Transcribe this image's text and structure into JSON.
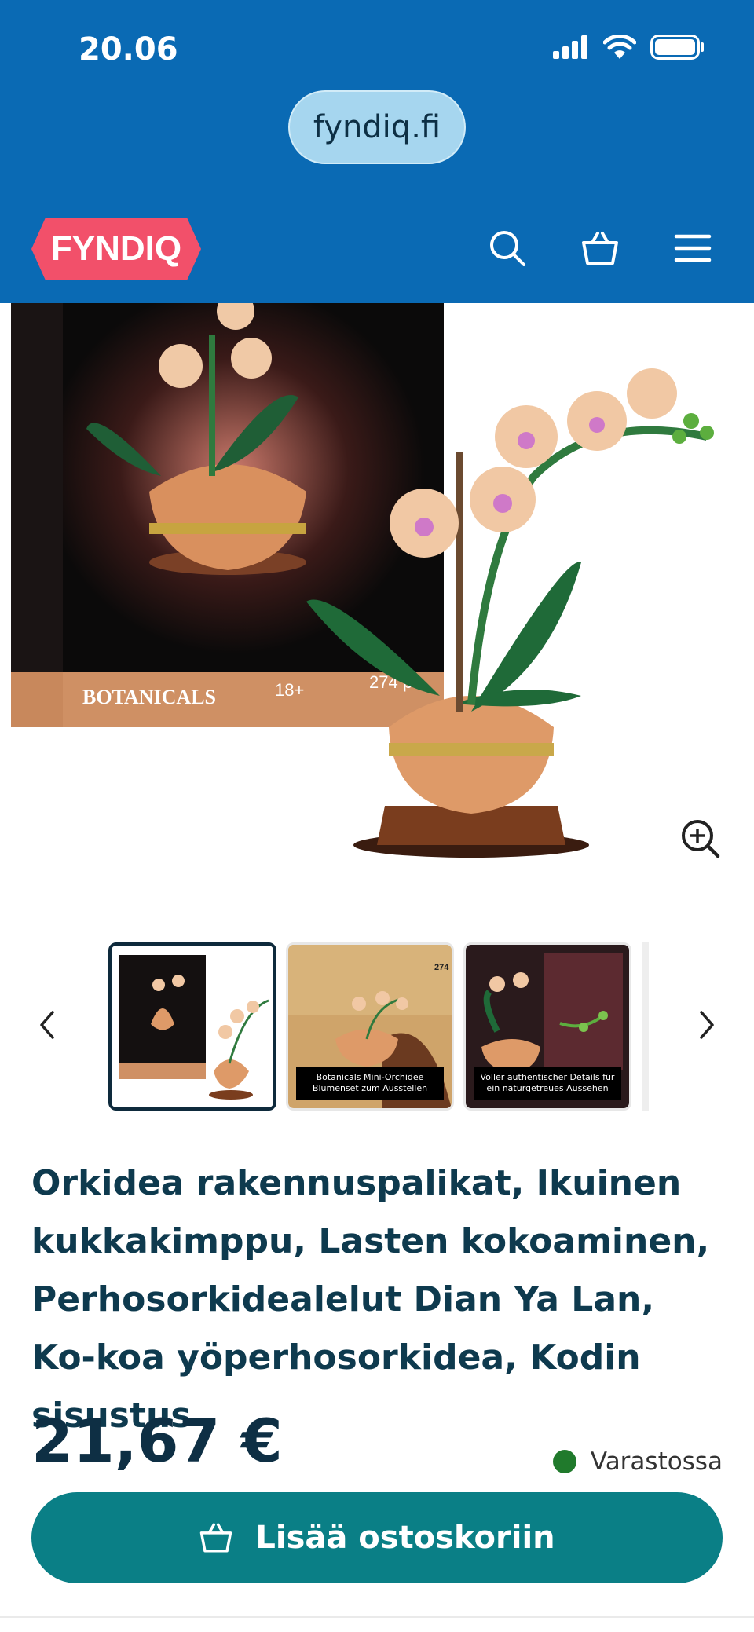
{
  "status_bar": {
    "time": "20.06"
  },
  "browser": {
    "url": "fyndiq.fi"
  },
  "header": {
    "logo_text": "FYNDIQ",
    "brand_color": "#f2506a",
    "icons": [
      "search-icon",
      "cart-icon",
      "menu-icon"
    ]
  },
  "product_image": {
    "box_brand": "BOTANICALS",
    "box_age": "18+",
    "box_pieces": "274 pc"
  },
  "thumbnails": [
    {
      "caption": ""
    },
    {
      "caption": "Botanicals Mini-Orchidee Blumenset zum Ausstellen",
      "badge": "274"
    },
    {
      "caption": "Voller authentischer Details für ein naturgetreues Aussehen"
    }
  ],
  "product": {
    "title": "Orkidea rakennuspalikat, Ikuinen kukkakimppu, Lasten kokoaminen, Perhosorkidealelut Dian Ya Lan, Ko-koa yöperhosorkidea, Kodin sisustus",
    "price": "21,67 €",
    "stock_status": "Varastossa",
    "stock_color": "#207a2c"
  },
  "cart": {
    "button_label": "Lisää ostoskoriin",
    "color": "#0a7f86"
  }
}
